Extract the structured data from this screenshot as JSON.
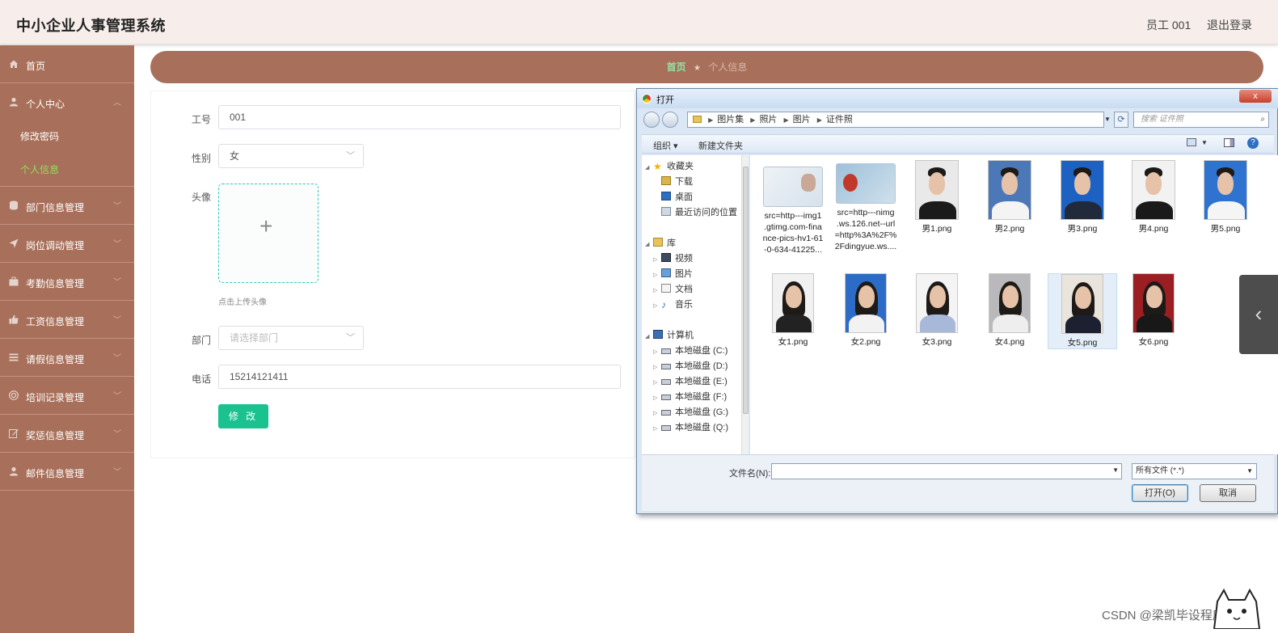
{
  "app": {
    "title": "中小企业人事管理系统",
    "user": "员工 001",
    "logout": "退出登录"
  },
  "sidebar": {
    "home": "首页",
    "personal_center": "个人中心",
    "personal_sub": [
      "修改密码",
      "个人信息"
    ],
    "groups": [
      "部门信息管理",
      "岗位调动管理",
      "考勤信息管理",
      "工资信息管理",
      "请假信息管理",
      "培训记录管理",
      "奖惩信息管理",
      "邮件信息管理"
    ]
  },
  "breadcrumb": {
    "home": "首页",
    "separator": "★",
    "current": "个人信息"
  },
  "form": {
    "employee_no_label": "工号",
    "employee_no": "001",
    "gender_label": "性别",
    "gender": "女",
    "avatar_label": "头像",
    "avatar_plus": "+",
    "avatar_hint": "点击上传头像",
    "dept_label": "部门",
    "dept_placeholder": "请选择部门",
    "phone_label": "电话",
    "phone": "15214121411",
    "submit": "修 改"
  },
  "dialog": {
    "title": "打开",
    "close": "x",
    "path": [
      "图片集",
      "照片",
      "图片",
      "证件照"
    ],
    "search_placeholder": "搜索 证件照",
    "toolbar": {
      "organize": "组织 ▾",
      "new_folder": "新建文件夹"
    },
    "nav": {
      "favorites": "收藏夹",
      "fav_items": [
        "下载",
        "桌面",
        "最近访问的位置"
      ],
      "library": "库",
      "lib_items": [
        "视频",
        "图片",
        "文档",
        "音乐"
      ],
      "computer": "计算机",
      "drives": [
        "本地磁盘 (C:)",
        "本地磁盘 (D:)",
        "本地磁盘 (E:)",
        "本地磁盘 (F:)",
        "本地磁盘 (G:)",
        "本地磁盘 (Q:)"
      ]
    },
    "files_row1": [
      {
        "name": "src=http---img1\n.gtimg.com-fina\nnce-pics-hv1-61\n-0-634-41225...",
        "kind": "card1"
      },
      {
        "name": "src=http---nimg\n.ws.126.net--url\n=http%3A%2F%\n2Fdingyue.ws....",
        "kind": "card2"
      },
      {
        "name": "男1.png",
        "kind": "male",
        "bg": "#e9e9e9",
        "shirt": "#1b1b1b"
      },
      {
        "name": "男2.png",
        "kind": "male",
        "bg": "#4c78b8",
        "shirt": "#f4f4f4"
      },
      {
        "name": "男3.png",
        "kind": "male",
        "bg": "#1d62c2",
        "shirt": "#202a3a"
      },
      {
        "name": "男4.png",
        "kind": "male",
        "bg": "#f2f2f2",
        "shirt": "#1a1a1a"
      },
      {
        "name": "男5.png",
        "kind": "male",
        "bg": "#2f73d0",
        "shirt": "#f5f5f5"
      }
    ],
    "files_row2": [
      {
        "name": "女1.png",
        "kind": "female",
        "bg": "#f1f1f1",
        "shirt": "#222"
      },
      {
        "name": "女2.png",
        "kind": "female",
        "bg": "#2c6cc6",
        "shirt": "#f2f2f2"
      },
      {
        "name": "女3.png",
        "kind": "female",
        "bg": "#f4f4f4",
        "shirt": "#a7b8d9"
      },
      {
        "name": "女4.png",
        "kind": "female",
        "bg": "#b9b9bb",
        "shirt": "#eeeeee"
      },
      {
        "name": "女5.png",
        "kind": "female",
        "bg": "#e9e4dc",
        "shirt": "#1d2030"
      },
      {
        "name": "女6.png",
        "kind": "female",
        "bg": "#9b1e22",
        "shirt": "#181818"
      }
    ],
    "filename_label": "文件名(N):",
    "filename_value": "",
    "filter": "所有文件 (*.*)",
    "open": "打开(O)",
    "cancel": "取消"
  },
  "side_tab_icon": "‹",
  "watermark": "CSDN @梁凯毕设程序",
  "colors": {
    "sidebar": "#a8705a",
    "accent_green": "#19c28e",
    "active_sub": "#8fe25b"
  }
}
